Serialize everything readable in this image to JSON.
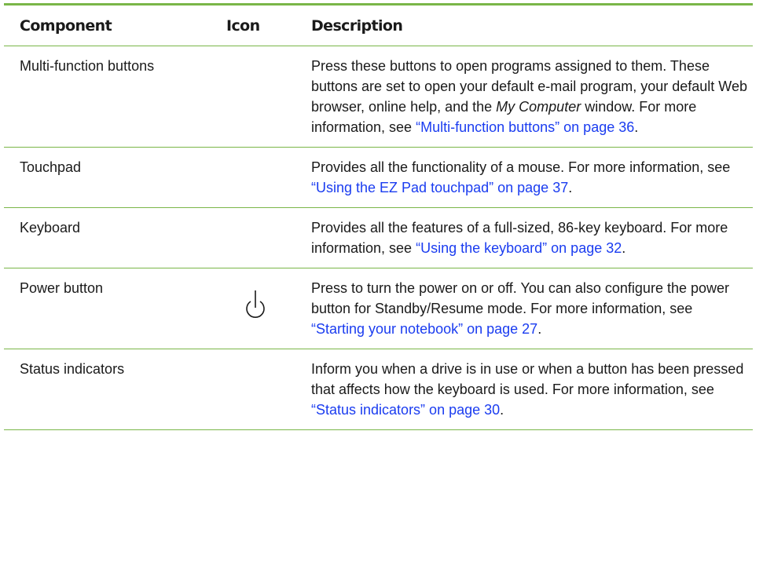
{
  "header": {
    "component": "Component",
    "icon": "Icon",
    "description": "Description"
  },
  "rows": [
    {
      "component": "Multi-function buttons",
      "icon": "",
      "desc_a": "Press these buttons to open programs assigned to them. These buttons are set to open your default e-mail program, your default Web browser, online help, and the ",
      "desc_em": "My Computer",
      "desc_b": " window. For more information, see ",
      "link": "“Multi-function buttons” on page 36",
      "desc_end": "."
    },
    {
      "component": "Touchpad",
      "icon": "",
      "desc_a": "Provides all the functionality of a mouse. For more information, see ",
      "link": "“Using the EZ Pad touchpad” on page 37",
      "desc_end": "."
    },
    {
      "component": "Keyboard",
      "icon": "",
      "desc_a": "Provides all the features of a full-sized, 86-key keyboard. For more information, see ",
      "link": "“Using the keyboard” on page 32",
      "desc_end": "."
    },
    {
      "component": "Power button",
      "icon": "power-icon",
      "desc_a": "Press to turn the power on or off. You can also configure the power button for Standby/Resume mode. For more information, see ",
      "link": "“Starting your notebook” on page 27",
      "desc_end": "."
    },
    {
      "component": "Status indicators",
      "icon": "",
      "desc_a": "Inform you when a drive is in use or when a button has been pressed that affects how the keyboard is used. For more information, see ",
      "link": "“Status indicators” on page 30",
      "desc_end": "."
    }
  ],
  "colors": {
    "rule": "#7ab648",
    "link": "#1a3cf0",
    "text": "#1a1a1a"
  }
}
